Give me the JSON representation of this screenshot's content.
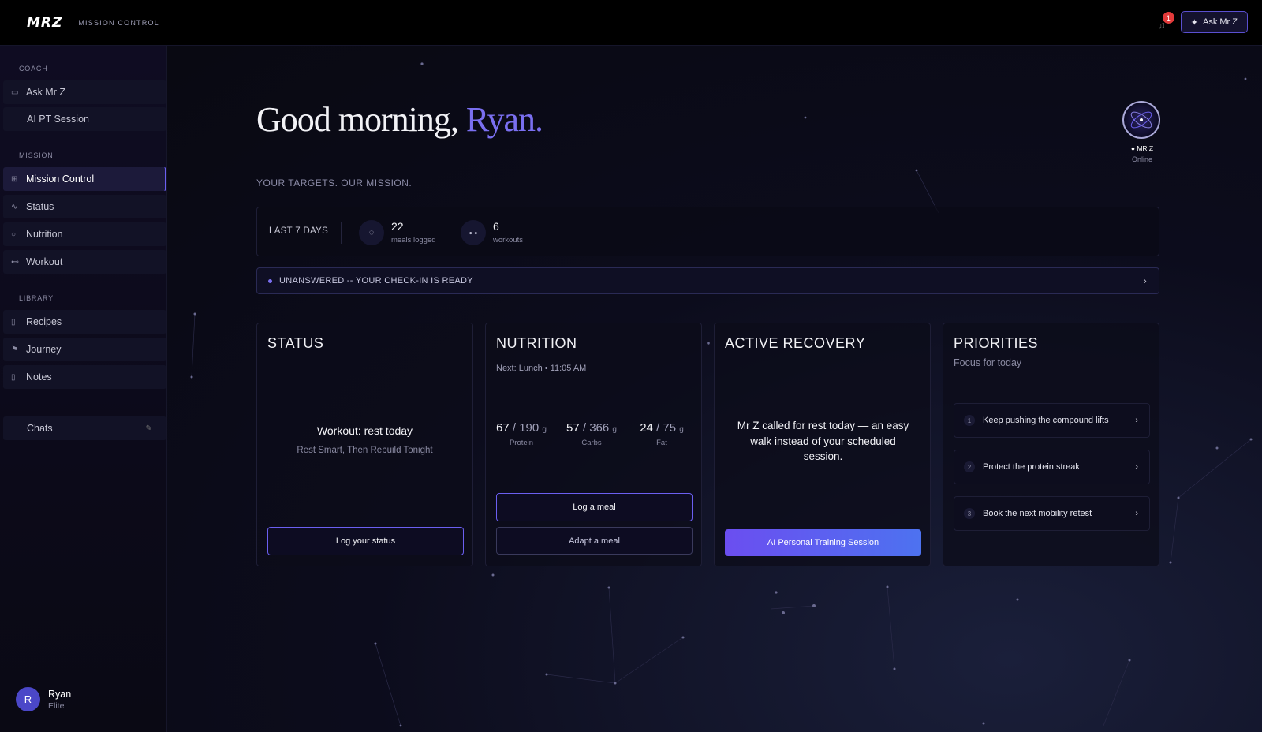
{
  "header": {
    "logo": "MRZ",
    "subtitle": "MISSION CONTROL",
    "notification_count": "1",
    "ask_button": "Ask Mr Z"
  },
  "sidebar": {
    "sections": {
      "coach": "COACH",
      "mission": "MISSION",
      "library": "LIBRARY"
    },
    "coach_items": [
      {
        "label": "Ask Mr Z",
        "icon": "chat-icon"
      },
      {
        "label": "AI PT Session",
        "icon": ""
      }
    ],
    "mission_items": [
      {
        "label": "Mission Control",
        "icon": "grid-icon"
      },
      {
        "label": "Status",
        "icon": "pulse-icon"
      },
      {
        "label": "Nutrition",
        "icon": "apple-icon"
      },
      {
        "label": "Workout",
        "icon": "dumbbell-icon"
      }
    ],
    "library_items": [
      {
        "label": "Recipes",
        "icon": "book-icon"
      },
      {
        "label": "Journey",
        "icon": "flag-icon"
      },
      {
        "label": "Notes",
        "icon": "notebook-icon"
      }
    ],
    "chats_label": "Chats",
    "user": {
      "initial": "R",
      "name": "Ryan",
      "tier": "Elite"
    }
  },
  "main": {
    "greeting": "Good morning,",
    "greeting_name": "Ryan.",
    "mrz_name": "● MR Z",
    "mrz_status": "Online",
    "tagline": "YOUR TARGETS. OUR MISSION.",
    "stats": {
      "period": "LAST 7 DAYS",
      "meals": {
        "value": "22",
        "label": "meals logged"
      },
      "workouts": {
        "value": "6",
        "label": "workouts"
      }
    },
    "checkin": "UNANSWERED -- YOUR CHECK-IN IS READY",
    "status_card": {
      "title": "STATUS",
      "headline": "Workout: rest today",
      "sub": "Rest Smart, Then Rebuild Tonight",
      "button": "Log your status"
    },
    "nutrition_card": {
      "title": "NUTRITION",
      "next": "Next: Lunch • 11:05 AM",
      "macros": [
        {
          "value": "67",
          "total": "/ 190",
          "unit": "g",
          "label": "Protein"
        },
        {
          "value": "57",
          "total": "/ 366",
          "unit": "g",
          "label": "Carbs"
        },
        {
          "value": "24",
          "total": "/ 75",
          "unit": "g",
          "label": "Fat"
        }
      ],
      "log_button": "Log a meal",
      "adapt_button": "Adapt a meal"
    },
    "recovery_card": {
      "title": "ACTIVE RECOVERY",
      "text": "Mr Z called for rest today — an easy walk instead of your scheduled session.",
      "button": "AI Personal Training Session"
    },
    "priorities_card": {
      "title": "PRIORITIES",
      "subtitle": "Focus for today",
      "items": [
        {
          "num": "1",
          "label": "Keep pushing the compound lifts"
        },
        {
          "num": "2",
          "label": "Protect the protein streak"
        },
        {
          "num": "3",
          "label": "Book the next mobility retest"
        }
      ]
    }
  },
  "colors": {
    "accent": "#6b5ff0",
    "background": "#0c0c1c",
    "alert": "#e23a3a"
  }
}
